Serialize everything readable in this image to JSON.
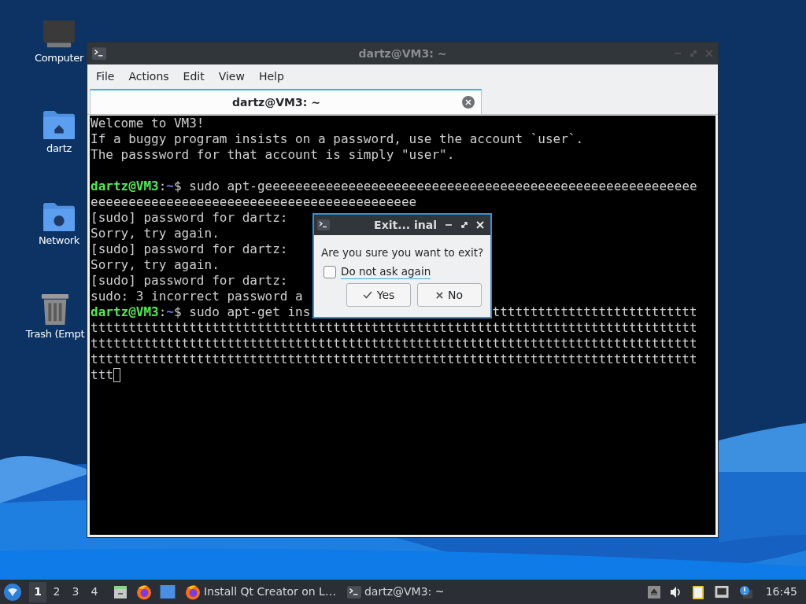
{
  "desktop_icons": [
    {
      "label": "Computer",
      "kind": "computer"
    },
    {
      "label": "dartz",
      "kind": "home"
    },
    {
      "label": "Network",
      "kind": "network"
    },
    {
      "label": "Trash (Empt",
      "kind": "trash"
    }
  ],
  "window": {
    "title": "dartz@VM3: ~",
    "menu": [
      "File",
      "Actions",
      "Edit",
      "View",
      "Help"
    ],
    "tabs": [
      {
        "label": "dartz@VM3: ~",
        "selected": true
      }
    ]
  },
  "terminal": {
    "lines": [
      {
        "kind": "text",
        "text": "Welcome to VM3!"
      },
      {
        "kind": "text",
        "text": "If a buggy program insists on a password, use the account `user`."
      },
      {
        "kind": "text",
        "text": "The passsword for that account is simply \"user\"."
      },
      {
        "kind": "blank"
      },
      {
        "kind": "prompt",
        "user": "dartz@VM3",
        "colon": ":",
        "path": "~",
        "dollar": "$",
        "command": "sudo apt-geeeeeeeeeeeeeeeeeeeeeeeeeeeeeeeeeeeeeeeeeeeeeeeeeeeeeeeee"
      },
      {
        "kind": "text",
        "text": "eeeeeeeeeeeeeeeeeeeeeeeeeeeeeeeeeeeeeeeeeee"
      },
      {
        "kind": "text",
        "text": "[sudo] password for dartz:"
      },
      {
        "kind": "text",
        "text": "Sorry, try again."
      },
      {
        "kind": "text",
        "text": "[sudo] password for dartz:"
      },
      {
        "kind": "text",
        "text": "Sorry, try again."
      },
      {
        "kind": "text",
        "text": "[sudo] password for dartz:"
      },
      {
        "kind": "text",
        "text": "sudo: 3 incorrect password a"
      },
      {
        "kind": "prompt",
        "user": "dartz@VM3",
        "colon": ":",
        "path": "~",
        "dollar": "$",
        "command": "sudo apt-get ins",
        "tail": "ttttttttttttttttttttttttttt"
      },
      {
        "kind": "text",
        "text": "tttttttttttttttttttttttttttttttttttttttttttttttttttttttttttttttttttttttttttttttt"
      },
      {
        "kind": "text",
        "text": "tttttttttttttttttttttttttttttttttttttttttttttttttttttttttttttttttttttttttttttttt"
      },
      {
        "kind": "text",
        "text": "tttttttttttttttttttttttttttttttttttttttttttttttttttttttttttttttttttttttttttttttt"
      },
      {
        "kind": "cursor",
        "text": "ttt"
      }
    ]
  },
  "dialog": {
    "title": "Exit... inal",
    "message": "Are you sure you want to exit?",
    "checkbox": {
      "label": "Do not ask again",
      "checked": false
    },
    "buttons": [
      {
        "label": "Yes",
        "kind": "yes"
      },
      {
        "label": "No",
        "kind": "no"
      }
    ]
  },
  "taskbar": {
    "workspaces": [
      {
        "label": "1",
        "selected": true
      },
      {
        "label": "2",
        "selected": false
      },
      {
        "label": "3",
        "selected": false
      },
      {
        "label": "4",
        "selected": false
      }
    ],
    "tasks": [
      {
        "label": "Install Qt Creator on L…",
        "kind": "browser"
      },
      {
        "label": "dartz@VM3: ~",
        "kind": "terminal"
      }
    ],
    "clock": "16:45"
  }
}
